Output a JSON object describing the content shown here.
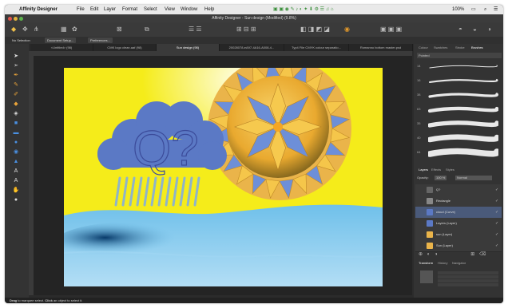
{
  "menubar": {
    "app_name": "Affinity Designer",
    "items": [
      "File",
      "Edit",
      "Layer",
      "Format",
      "Select",
      "View",
      "Window",
      "Help"
    ],
    "clock": "100%"
  },
  "title": "Affinity Designer - Sun design (Modified) (9.8%)",
  "context": {
    "selection": "No Selection",
    "doc_setup": "Document Setup...",
    "preferences": "Preferences..."
  },
  "doc_tabs": [
    "<Untitled> (98)",
    "CMK logo clean.aaf (98)",
    "Sun design (98)",
    "20028078-eA97-4A16-A008-4...",
    "Typ4 File CMYK colour separatio...",
    "Romanno bottom master.psd"
  ],
  "panel_tabs": [
    "Colour",
    "Swatches",
    "Stroke",
    "Brushes"
  ],
  "brush_category": "Pointed",
  "brush_sizes": [
    "14",
    "16",
    "38",
    "63",
    "35",
    "40",
    "64"
  ],
  "layers_tabs": [
    "Layers",
    "Effects",
    "Styles"
  ],
  "opacity_label": "Opacity:",
  "opacity_value": "100 %",
  "blend_mode": "Normal",
  "layers": [
    {
      "name": "Q?",
      "type": "text"
    },
    {
      "name": "Rectangle",
      "type": "shape"
    },
    {
      "name": "cloud",
      "suffix": "(Curve)"
    },
    {
      "name": "Layers",
      "suffix": "(Layer)"
    },
    {
      "name": "sun",
      "suffix": "(Layer)"
    },
    {
      "name": "Sun",
      "suffix": "(Layer)"
    }
  ],
  "transform_tabs": [
    "Transform",
    "History",
    "Navigator"
  ],
  "status_bar": {
    "bold1": "Drag",
    "text1": " to marquee select. ",
    "bold2": "Click",
    "text2": " an object to select it."
  },
  "artwork": {
    "cloud_text": "Q?",
    "colors": {
      "background": "#f5ec1a",
      "cloud": "#5b79c5",
      "water": "#7dc3e8",
      "sun_blue": "#6d8fd8",
      "sun_orange": "#f5a623"
    }
  }
}
